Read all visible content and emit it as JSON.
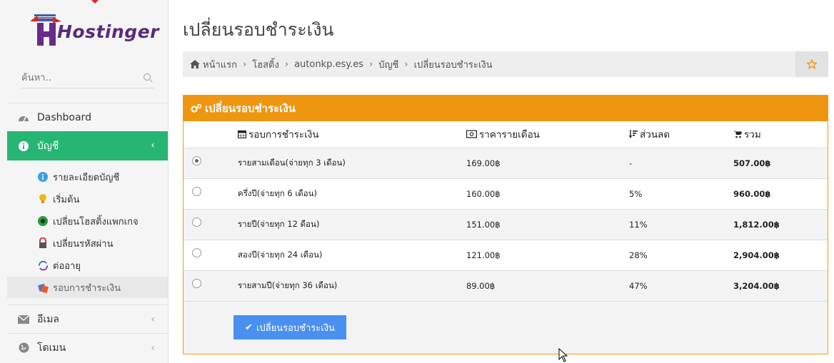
{
  "brand": {
    "logo_text": "Hostinger"
  },
  "search": {
    "placeholder": "ค้นหา.."
  },
  "sidebar": {
    "dashboard": "Dashboard",
    "account": "บัญชี",
    "account_sub": [
      {
        "label": "รายละเอียดบัญชี",
        "icon": "info-icon"
      },
      {
        "label": "เริ่มต้น",
        "icon": "bulb-icon"
      },
      {
        "label": "เปลี่ยนโฮสติ้งแพกเกจ",
        "icon": "package-icon"
      },
      {
        "label": "เปลี่ยนรหัสผ่าน",
        "icon": "lock-icon"
      },
      {
        "label": "ต่ออายุ",
        "icon": "refresh-icon"
      },
      {
        "label": "รอบการชำระเงิน",
        "icon": "billing-icon"
      }
    ],
    "email": "อีเมล",
    "domain": "โดเมน"
  },
  "page": {
    "title": "เปลี่ยนรอบชำระเงิน"
  },
  "breadcrumb": [
    "หน้าแรก",
    "โฮสติ้ง",
    "autonkp.esy.es",
    "บัญชี",
    "เปลี่ยนรอบชำระเงิน"
  ],
  "panel": {
    "title": "เปลี่ยนรอบชำระเงิน",
    "columns": {
      "period": "รอบการชำระเงิน",
      "price": "ราคารายเดือน",
      "discount": "ส่วนลด",
      "total": "รวม"
    },
    "rows": [
      {
        "period": "รายสามเดือน(จ่ายทุก 3 เดือน)",
        "price": "169.00฿",
        "discount": "-",
        "total": "507.00฿",
        "selected": true
      },
      {
        "period": "ครึ่งปี(จ่ายทุก 6 เดือน)",
        "price": "160.00฿",
        "discount": "5%",
        "total": "960.00฿",
        "selected": false
      },
      {
        "period": "รายปี(จ่ายทุก 12 ดือน)",
        "price": "151.00฿",
        "discount": "11%",
        "total": "1,812.00฿",
        "selected": false
      },
      {
        "period": "สองปี(จ่ายทุก 24 เดือน)",
        "price": "121.00฿",
        "discount": "28%",
        "total": "2,904.00฿",
        "selected": false
      },
      {
        "period": "รายสามปี(จ่ายทุก 36 เดือน)",
        "price": "89.00฿",
        "discount": "47%",
        "total": "3,204.00฿",
        "selected": false
      }
    ],
    "submit_label": "เปลี่ยนรอบชำระเงิน"
  },
  "colors": {
    "accent_green": "#27b574",
    "panel_orange": "#ef9611",
    "button_blue": "#4a90f0"
  }
}
